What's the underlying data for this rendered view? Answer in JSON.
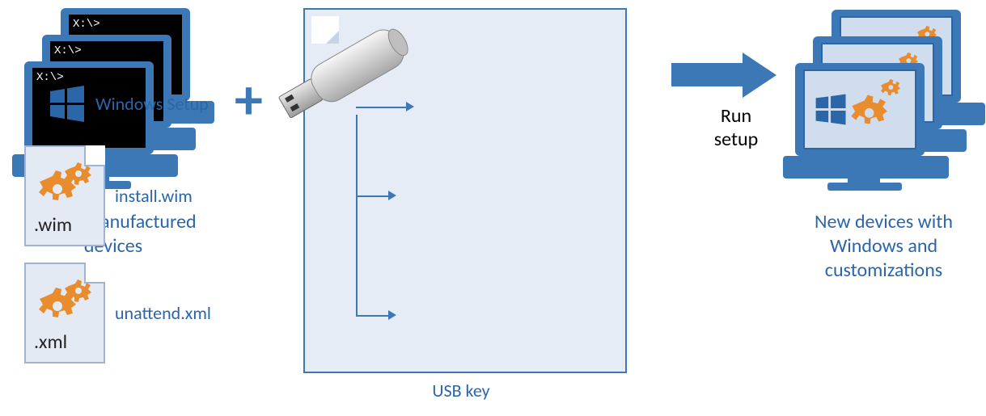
{
  "source": {
    "caption": "Newly-manufactured devices",
    "prompt": "X:\\>"
  },
  "operator": {
    "plus_symbol": "+"
  },
  "usb": {
    "caption": "USB key",
    "items": {
      "setup": {
        "label": "Windows Setup"
      },
      "wim": {
        "label": "install.wim",
        "ext": ".wim"
      },
      "xml": {
        "label": "unattend.xml",
        "ext": ".xml"
      }
    }
  },
  "action": {
    "label_line1": "Run",
    "label_line2": "setup"
  },
  "result": {
    "caption": "New devices with Windows and customizations"
  },
  "colors": {
    "blue": "#3c78b5",
    "orange": "#e88c2d",
    "panel": "#e5ecf6"
  }
}
